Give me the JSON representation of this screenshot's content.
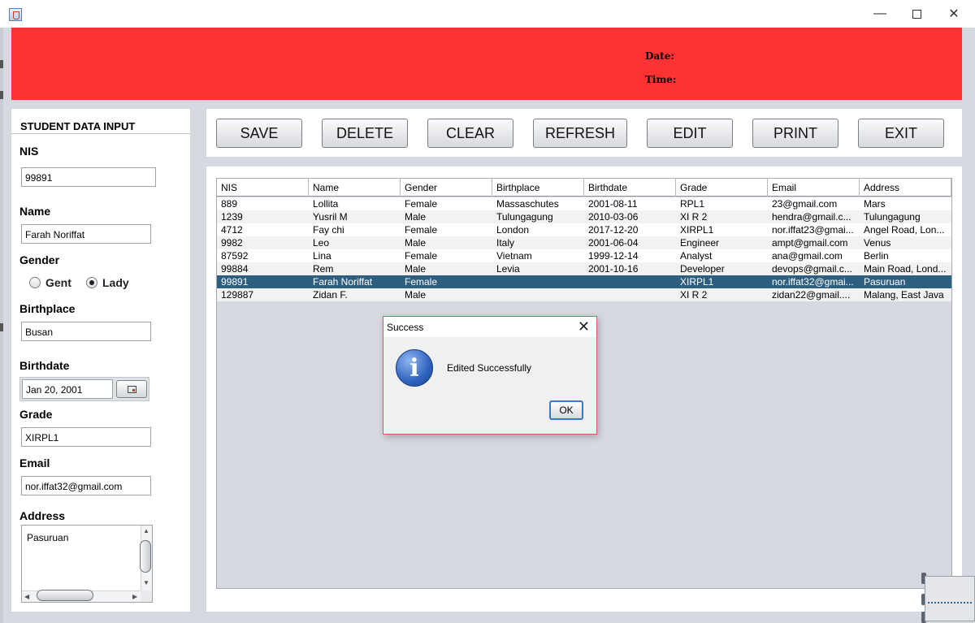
{
  "window": {
    "min_icon": "minimize-icon",
    "max_icon": "maximize-icon",
    "close_icon": "close-icon",
    "min_glyph": "—",
    "close_glyph": "✕"
  },
  "header": {
    "date_label": "Date:",
    "time_label": "Time:",
    "bg_color": "#ff3333"
  },
  "form": {
    "title": "STUDENT DATA INPUT",
    "nis_label": "NIS",
    "nis_value": "99891",
    "name_label": "Name",
    "name_value": "Farah Noriffat",
    "gender_label": "Gender",
    "gender_options": [
      "Gent",
      "Lady"
    ],
    "gender_selected": "Lady",
    "birthplace_label": "Birthplace",
    "birthplace_value": "Busan",
    "birthdate_label": "Birthdate",
    "birthdate_value": "Jan 20, 2001",
    "grade_label": "Grade",
    "grade_value": "XIRPL1",
    "email_label": "Email",
    "email_value": "nor.iffat32@gmail.com",
    "address_label": "Address",
    "address_value": "Pasuruan"
  },
  "toolbar": {
    "buttons": [
      "SAVE",
      "DELETE",
      "CLEAR",
      "REFRESH",
      "EDIT",
      "PRINT",
      "EXIT"
    ]
  },
  "table": {
    "columns": [
      "NIS",
      "Name",
      "Gender",
      "Birthplace",
      "Birthdate",
      "Grade",
      "Email",
      "Address"
    ],
    "selected_row": 6,
    "selection_color": "#2f5f80",
    "rows": [
      [
        "889",
        "Lollita",
        "Female",
        "Massaschutes",
        "2001-08-11",
        "RPL1",
        "23@gmail.com",
        "Mars"
      ],
      [
        "1239",
        "Yusril M",
        "Male",
        "Tulungagung",
        "2010-03-06",
        "XI R 2",
        "hendra@gmail.c...",
        "Tulungagung"
      ],
      [
        "4712",
        "Fay chi",
        "Female",
        "London",
        "2017-12-20",
        "XIRPL1",
        "nor.iffat23@gmai...",
        "Angel Road, Lon..."
      ],
      [
        "9982",
        "Leo",
        "Male",
        "Italy",
        "2001-06-04",
        "Engineer",
        "ampt@gmail.com",
        "Venus"
      ],
      [
        "87592",
        "Lina",
        "Female",
        "Vietnam",
        "1999-12-14",
        "Analyst",
        "ana@gmail.com",
        "Berlin"
      ],
      [
        "99884",
        "Rem",
        "Male",
        "Levia",
        "2001-10-16",
        "Developer",
        "devops@gmail.c...",
        "Main Road, Lond..."
      ],
      [
        "99891",
        "Farah Noriffat",
        "Female",
        "",
        "",
        "XIRPL1",
        "nor.iffat32@gmai...",
        "Pasuruan"
      ],
      [
        "129887",
        "Zidan F.",
        "Male",
        "",
        "",
        "XI R 2",
        "zidan22@gmail....",
        "Malang, East Java"
      ]
    ]
  },
  "dialog": {
    "title": "Success",
    "message": "Edited Successfully",
    "ok_label": "OK",
    "icon": "info-icon",
    "close_glyph": "✕",
    "border_color": "#d05a6a"
  }
}
